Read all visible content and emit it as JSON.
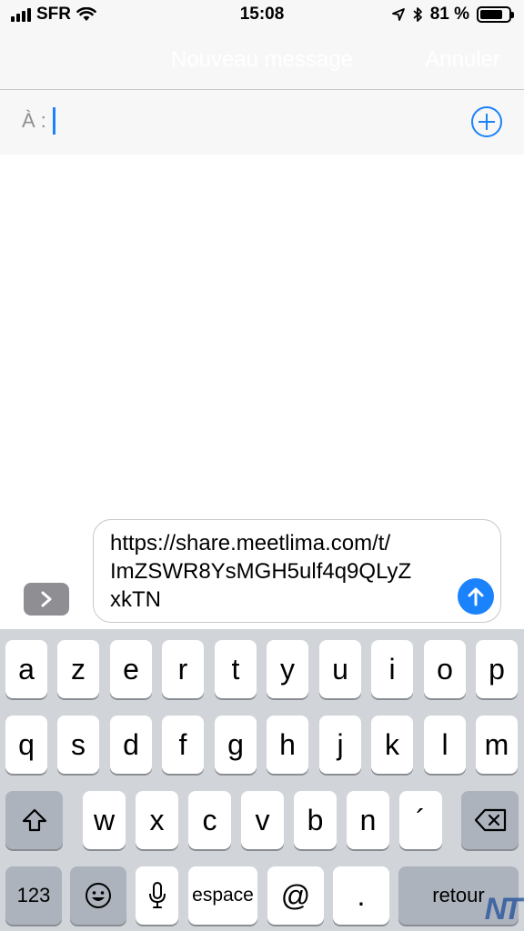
{
  "status_bar": {
    "carrier": "SFR",
    "time": "15:08",
    "battery": "81 %",
    "battery_level": 0.81
  },
  "nav": {
    "title": "Nouveau message",
    "cancel": "Annuler"
  },
  "to_field": {
    "label": "À :",
    "value": ""
  },
  "compose": {
    "line1": "https://share.meetlima.com/t/",
    "line2": "ImZSWR8YsMGH5ulf4q9QLyZ",
    "line3": "xkTN"
  },
  "keyboard": {
    "row1": [
      "a",
      "z",
      "e",
      "r",
      "t",
      "y",
      "u",
      "i",
      "o",
      "p"
    ],
    "row2": [
      "q",
      "s",
      "d",
      "f",
      "g",
      "h",
      "j",
      "k",
      "l",
      "m"
    ],
    "row3": [
      "w",
      "x",
      "c",
      "v",
      "b",
      "n",
      "´"
    ],
    "numbers": "123",
    "space": "espace",
    "at": "@",
    "period": ".",
    "return": "retour"
  },
  "watermark": "NT",
  "colors": {
    "accent": "#1a82fb",
    "keyboard_bg": "#d1d4d9",
    "key_bg": "#ffffff",
    "special_key_bg": "#acb3bd"
  }
}
